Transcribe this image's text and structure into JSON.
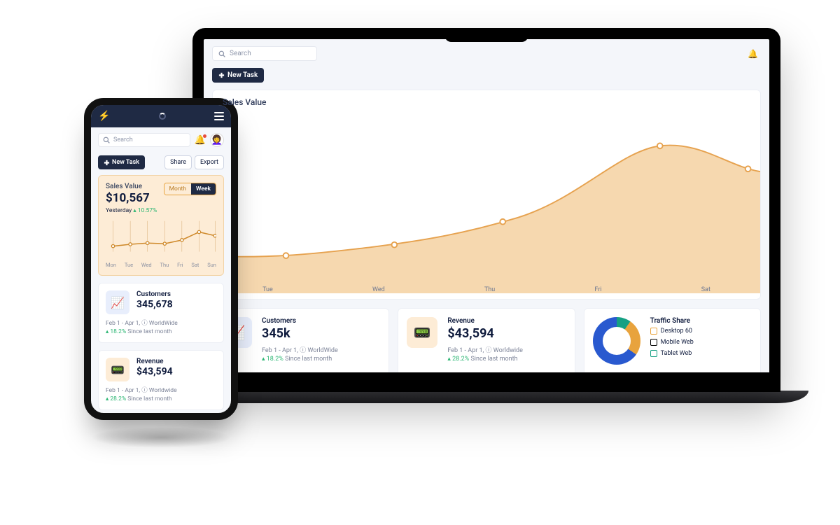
{
  "search_placeholder": "Search",
  "new_task_label": "New Task",
  "sales_title": "Sales Value",
  "sales_phone": {
    "value": "$10,567",
    "sub_prefix": "Yesterday",
    "sub_growth": "10.57%",
    "toggle_month": "Month",
    "toggle_week": "Week"
  },
  "days7": [
    "Mon",
    "Tue",
    "Wed",
    "Thu",
    "Fri",
    "Sat",
    "Sun"
  ],
  "days_lap": [
    "Tue",
    "Wed",
    "Thu",
    "Fri",
    "Sat"
  ],
  "btn_share": "Share",
  "btn_export": "Export",
  "customers": {
    "label": "Customers",
    "value_phone": "345,678",
    "value_lap": "345k",
    "meta": "Feb 1 - Apr 1, ⓘ WorldWide",
    "growth": "18.2%",
    "since": "Since last month"
  },
  "revenue": {
    "label": "Revenue",
    "value": "$43,594",
    "meta": "Feb 1 - Apr 1, ⓘ Worldwide",
    "growth": "28.2%",
    "since": "Since last month"
  },
  "traffic": {
    "label": "Traffic Share",
    "items": [
      "Desktop 60",
      "Mobile Web",
      "Tablet Web"
    ],
    "colors": [
      "#e8a33d",
      "#000",
      "#15a083"
    ]
  },
  "chart_data": {
    "type": "line",
    "title": "Sales Value",
    "xlabel": "",
    "ylabel": "",
    "phone_week": {
      "categories": [
        "Mon",
        "Tue",
        "Wed",
        "Thu",
        "Fri",
        "Sat",
        "Sun"
      ],
      "values": [
        28,
        31,
        33,
        32,
        38,
        47,
        43
      ]
    },
    "laptop_week": {
      "categories": [
        "Tue",
        "Wed",
        "Thu",
        "Fri",
        "Sat"
      ],
      "values": [
        16,
        21,
        34,
        68,
        58
      ]
    }
  }
}
